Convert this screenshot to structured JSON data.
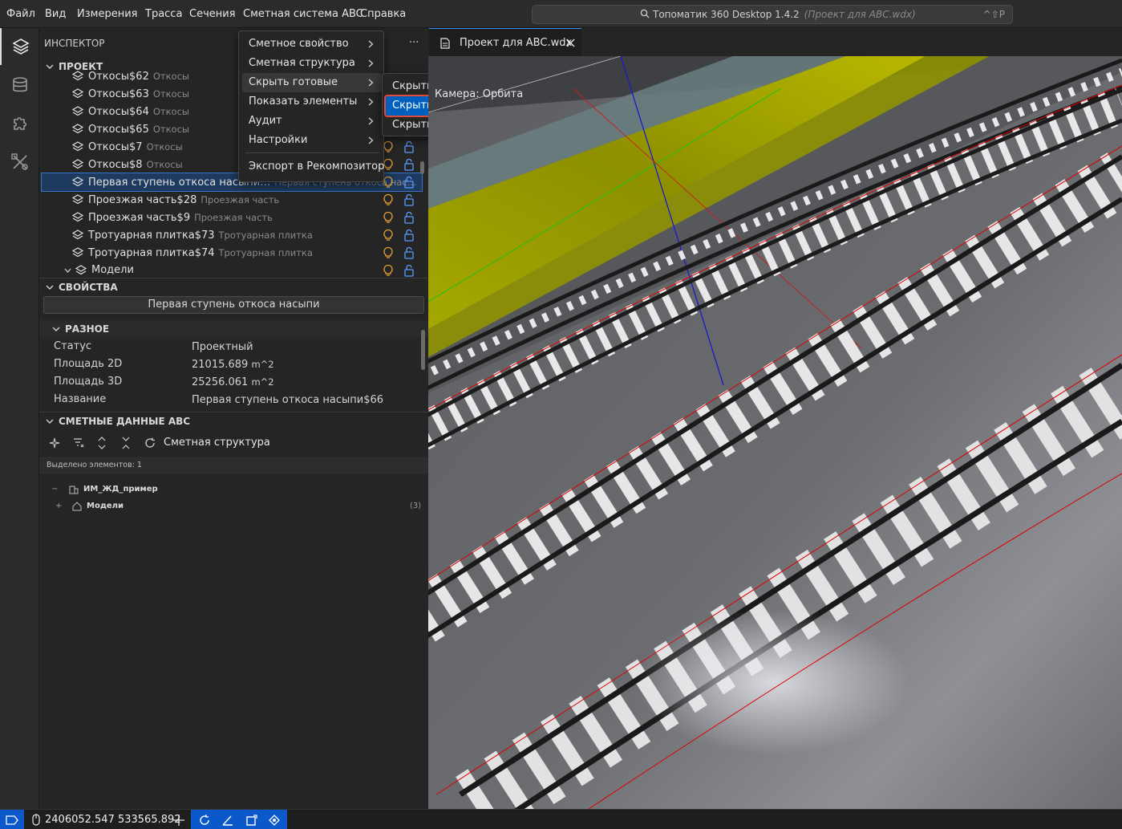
{
  "menubar": {
    "items": [
      "Файл",
      "Вид",
      "Измерения",
      "Трасса",
      "Сечения",
      "Сметная система ABC",
      "Справка"
    ],
    "command_center": {
      "title": "Топоматик 360 Desktop 1.4.2",
      "project": "(Проект для ABC.wdx)",
      "shortcut": "^⇧P"
    }
  },
  "activity_bar": {
    "icons": [
      "layers-icon",
      "database-icon",
      "puzzle-icon",
      "tools-icon"
    ]
  },
  "inspector": {
    "title": "ИНСПЕКТОР",
    "more": "···",
    "project_label": "ПРОЕКТ",
    "rows": [
      {
        "name": "Откосы$62",
        "desc": "Откосы"
      },
      {
        "name": "Откосы$63",
        "desc": "Откосы"
      },
      {
        "name": "Откосы$64",
        "desc": "Откосы"
      },
      {
        "name": "Откосы$65",
        "desc": "Откосы"
      },
      {
        "name": "Откосы$7",
        "desc": "Откосы"
      },
      {
        "name": "Откосы$8",
        "desc": "Откосы"
      },
      {
        "name": "Первая ступень откоса насыпи…",
        "desc": "Первая ступень откоса нас…",
        "selected": true
      },
      {
        "name": "Проезжая часть$28",
        "desc": "Проезжая часть"
      },
      {
        "name": "Проезжая часть$9",
        "desc": "Проезжая часть"
      },
      {
        "name": "Тротуарная плитка$73",
        "desc": "Тротуарная плитка"
      },
      {
        "name": "Тротуарная плитка$74",
        "desc": "Тротуарная плитка"
      }
    ],
    "models_label": "Модели"
  },
  "properties": {
    "title": "СВОЙСТВА",
    "object_name": "Первая ступень откоса насыпи",
    "group": "РАЗНОЕ",
    "items": [
      {
        "key": "Статус",
        "value": "Проектный",
        "unit": ""
      },
      {
        "key": "Площадь 2D",
        "value": "21015.689",
        "unit": "m^2"
      },
      {
        "key": "Площадь 3D",
        "value": "25256.061",
        "unit": "m^2"
      },
      {
        "key": "Название",
        "value": "Первая ступень откоса насыпи$66",
        "unit": ""
      }
    ]
  },
  "abc": {
    "title": "СМЕТНЫЕ ДАННЫЕ ABC",
    "toolbar_label": "Сметная структура",
    "selected_count": "Выделено элементов: 1",
    "tree": [
      {
        "toggle": "−",
        "label": "ИМ_ЖД_пример",
        "count": ""
      },
      {
        "toggle": "+",
        "label": "Модели",
        "count": "(3)"
      }
    ]
  },
  "context_menu": {
    "items": [
      "Сметное свойство",
      "Сметная структура",
      "Скрыть готовые",
      "Показать элементы",
      "Аудит",
      "Настройки"
    ],
    "export": "Экспорт в Рекомпозитор",
    "submenu": [
      "Скрыть со сметным свойством",
      "Скрыть отнесенные к сметной структуре",
      "Скрыть выделенные"
    ]
  },
  "viewport": {
    "tab": "Проект для ABC.wdx",
    "camera": "Камера: Орбита"
  },
  "statusbar": {
    "coords": "2406052.547 533565.892"
  },
  "colors": {
    "accent": "#0a58ca",
    "selection": "#1e3a5f",
    "highlight_border": "#e04a3a",
    "bulb": "#e8a03a",
    "lock": "#5a9cff"
  }
}
